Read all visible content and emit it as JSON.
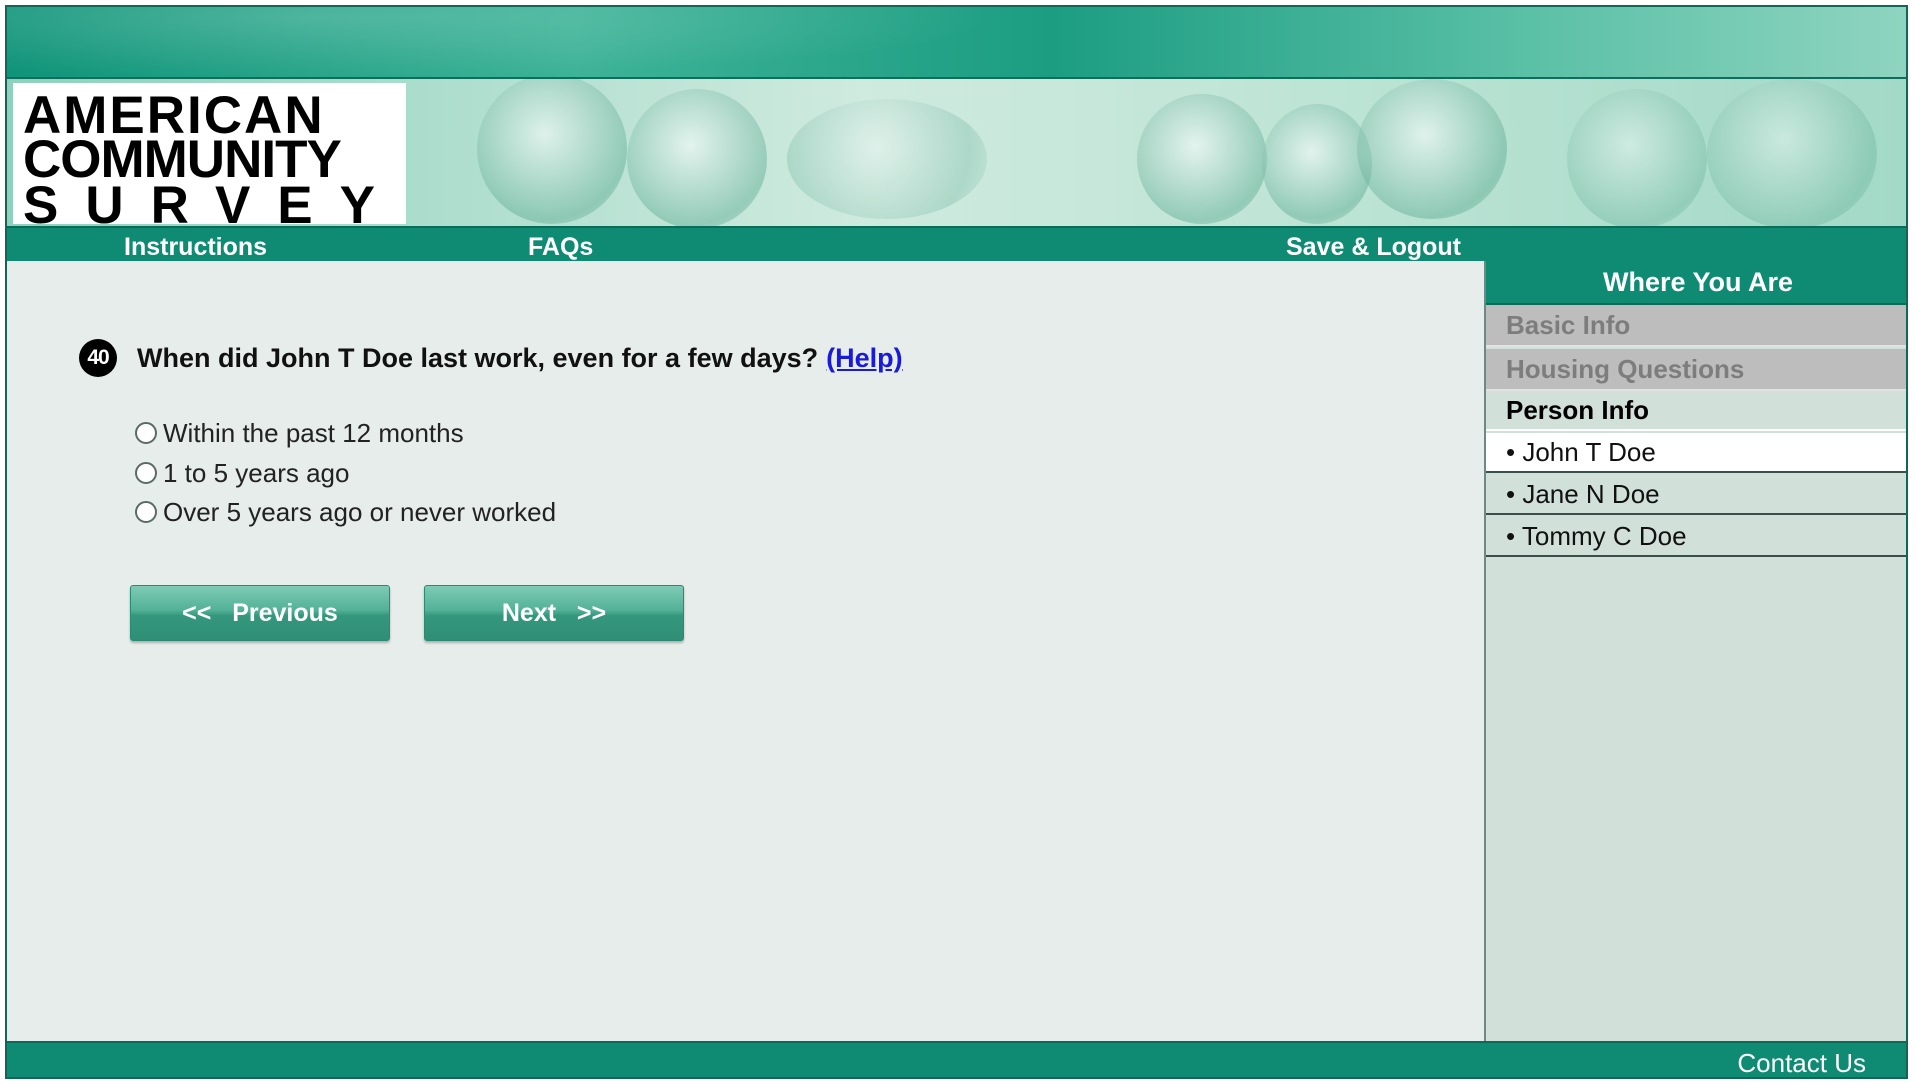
{
  "logo": {
    "line1": "AMERICAN",
    "line2": "COMMUNITY",
    "line3": "SURVEY"
  },
  "nav": {
    "instructions": "Instructions",
    "faqs": "FAQs",
    "save_logout": "Save & Logout"
  },
  "question": {
    "number": "40",
    "text": "When did John T Doe last work, even for a few days?",
    "help_label": "(Help)",
    "options": [
      "Within the past 12 months",
      "1 to 5 years ago",
      "Over 5 years ago or never worked"
    ]
  },
  "buttons": {
    "previous": "<<   Previous",
    "next": "Next   >>"
  },
  "sidebar": {
    "title": "Where You Are",
    "basic_info": "Basic Info",
    "housing": "Housing Questions",
    "person_info": "Person Info",
    "persons": [
      "• John T Doe",
      "• Jane N Doe",
      "• Tommy C Doe"
    ],
    "current_person": "John T Doe"
  },
  "footer": {
    "contact": "Contact Us"
  },
  "colors": {
    "brand_green": "#0e8b72",
    "link_blue": "#1a1adb",
    "content_bg": "#e6edea"
  }
}
